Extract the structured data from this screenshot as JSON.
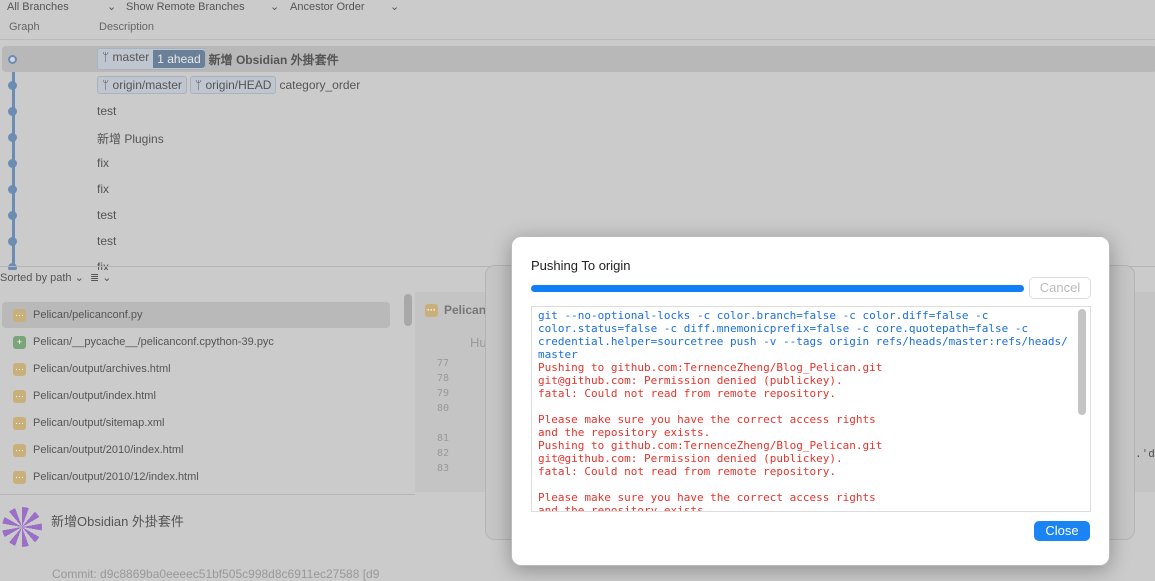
{
  "toolbar": {
    "branches": "All Branches",
    "remote": "Show Remote Branches",
    "order": "Ancestor Order"
  },
  "columns": {
    "graph": "Graph",
    "description": "Description"
  },
  "commits": [
    {
      "branch": "master",
      "ahead": "1 ahead",
      "message": "新增 Obsidian 外掛套件"
    },
    {
      "tags": [
        "origin/master",
        "origin/HEAD"
      ],
      "message": "category_order"
    },
    {
      "message": "test"
    },
    {
      "message": "新增 Plugins"
    },
    {
      "message": "fix"
    },
    {
      "message": "fix"
    },
    {
      "message": "test"
    },
    {
      "message": "test"
    },
    {
      "message": "fix"
    }
  ],
  "files_toolbar": {
    "sort": "Sorted by path"
  },
  "files": [
    {
      "path": "Pelican/pelicanconf.py",
      "status": "modified"
    },
    {
      "path": "Pelican/__pycache__/pelicanconf.cpython-39.pyc",
      "status": "added"
    },
    {
      "path": "Pelican/output/archives.html",
      "status": "modified"
    },
    {
      "path": "Pelican/output/index.html",
      "status": "modified"
    },
    {
      "path": "Pelican/output/sitemap.xml",
      "status": "modified"
    },
    {
      "path": "Pelican/output/2010/index.html",
      "status": "modified"
    },
    {
      "path": "Pelican/output/2010/12/index.html",
      "status": "modified"
    }
  ],
  "diff": {
    "file": "Pelican",
    "hunk": "Hu",
    "lines": [
      "77",
      "78",
      "79",
      "80",
      "81",
      "82",
      "83"
    ],
    "snippet": ".'di"
  },
  "commit_detail": {
    "message": "新增Obsidian 外掛套件",
    "commit_label": "Commit:",
    "commit_hash": "d9c8869ba0eeeec51bf505c998d8c6911ec27588 [d9"
  },
  "dialog": {
    "title": "Pushing To origin",
    "progress": 1.0,
    "cancel": "Cancel",
    "close": "Close",
    "log_command": "git --no-optional-locks -c color.branch=false -c color.diff=false -c\ncolor.status=false -c diff.mnemonicprefix=false -c core.quotepath=false -c\ncredential.helper=sourcetree push -v --tags origin refs/heads/master:refs/heads/\nmaster",
    "log_error": "Pushing to github.com:TernenceZheng/Blog_Pelican.git\ngit@github.com: Permission denied (publickey).\nfatal: Could not read from remote repository.\n\nPlease make sure you have the correct access rights\nand the repository exists.\nPushing to github.com:TernenceZheng/Blog_Pelican.git\ngit@github.com: Permission denied (publickey).\nfatal: Could not read from remote repository.\n\nPlease make sure you have the correct access rights\nand the repository exists."
  },
  "colors": {
    "accent": "#1a84f4",
    "error": "#e8332b",
    "command": "#1a6fe0"
  }
}
